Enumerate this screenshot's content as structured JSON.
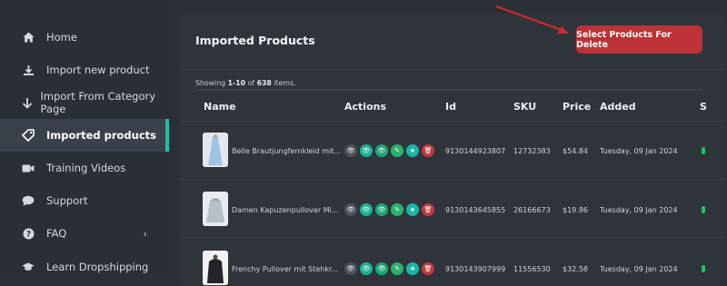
{
  "sidebar": {
    "items": [
      {
        "label": "Home",
        "icon": "home-icon"
      },
      {
        "label": "Import new product",
        "icon": "download-icon"
      },
      {
        "label": "Import From Category Page",
        "icon": "arrow-down-icon"
      },
      {
        "label": "Imported products",
        "icon": "tag-icon",
        "active": true
      },
      {
        "label": "Training Videos",
        "icon": "video-camera-icon"
      },
      {
        "label": "Support",
        "icon": "chat-icon"
      },
      {
        "label": "FAQ",
        "icon": "question-icon"
      },
      {
        "label": "Learn Dropshipping",
        "icon": "graduation-cap-icon"
      }
    ]
  },
  "panel": {
    "title": "Imported Products",
    "delete_button": "Select Products For Delete",
    "showing_prefix": "Showing ",
    "showing_range": "1-10",
    "showing_of": " of ",
    "showing_total": "638",
    "showing_suffix": " items."
  },
  "table": {
    "headers": [
      "Name",
      "Actions",
      "Id",
      "SKU",
      "Price",
      "Added",
      "S"
    ],
    "rows": [
      {
        "name": "Belle Brautjungfernkleid mit...",
        "id": "9130144923807",
        "sku": "12732383",
        "price": "$54.84",
        "added": "Tuesday, 09 Jan 2024"
      },
      {
        "name": "Damen Kapuzenpullover Mi...",
        "id": "9130143645855",
        "sku": "26166673",
        "price": "$19.86",
        "added": "Tuesday, 09 Jan 2024"
      },
      {
        "name": "Frenchy Pullover mit Stehkr...",
        "id": "9130143907999",
        "sku": "11556530",
        "price": "$32.58",
        "added": "Tuesday, 09 Jan 2024"
      }
    ]
  },
  "colors": {
    "accent": "#1fbfa3",
    "danger": "#bd3236",
    "status": "#22c25e"
  }
}
